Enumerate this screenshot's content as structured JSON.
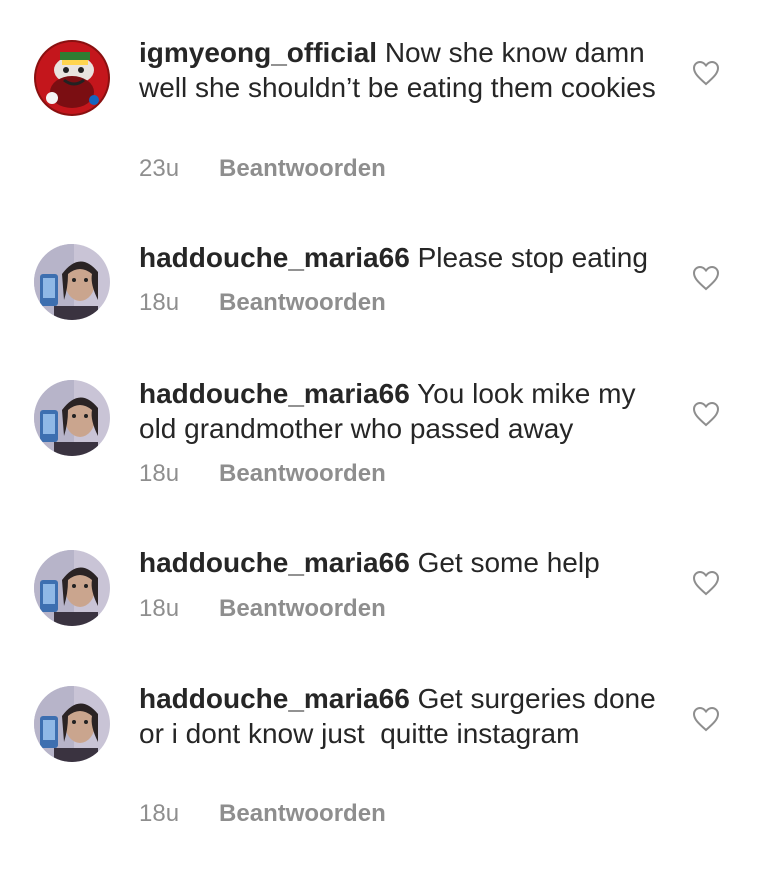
{
  "comments": [
    {
      "username": "igmyeong_official",
      "text": "Now she know damn well she shouldn’t be eating them cookies",
      "time": "23u",
      "reply_label": "Beantwoorden",
      "avatar_icon": "red-character-avatar"
    },
    {
      "username": "haddouche_maria66",
      "text": "Please stop eating",
      "time": "18u",
      "reply_label": "Beantwoorden",
      "avatar_icon": "selfie-avatar"
    },
    {
      "username": "haddouche_maria66",
      "text": "You look mike my old grandmother who passed away",
      "time": "18u",
      "reply_label": "Beantwoorden",
      "avatar_icon": "selfie-avatar"
    },
    {
      "username": "haddouche_maria66",
      "text": "Get some help",
      "time": "18u",
      "reply_label": "Beantwoorden",
      "avatar_icon": "selfie-avatar"
    },
    {
      "username": "haddouche_maria66",
      "text": "Get surgeries done or i dont know just  quitte instagram",
      "time": "18u",
      "reply_label": "Beantwoorden",
      "avatar_icon": "selfie-avatar"
    }
  ],
  "colors": {
    "text": "#262626",
    "meta": "#8e8e8e",
    "heart_stroke": "#8e8e8e"
  },
  "icons": {
    "like": "heart-outline-icon"
  }
}
